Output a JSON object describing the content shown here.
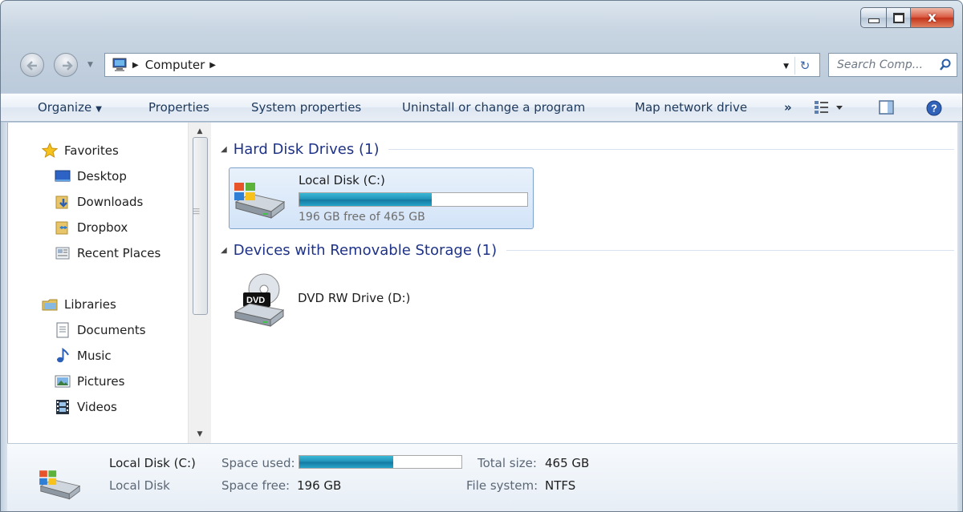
{
  "window": {
    "close_symbol": "x"
  },
  "address": {
    "crumb": "Computer",
    "search_placeholder": "Search Comp..."
  },
  "toolbar": {
    "organize": "Organize",
    "properties": "Properties",
    "system_properties": "System properties",
    "uninstall": "Uninstall or change a program",
    "map_drive": "Map network drive",
    "more": "»"
  },
  "sidebar": {
    "favorites_header": "Favorites",
    "favorites": [
      "Desktop",
      "Downloads",
      "Dropbox",
      "Recent Places"
    ],
    "libraries_header": "Libraries",
    "libraries": [
      "Documents",
      "Music",
      "Pictures",
      "Videos"
    ]
  },
  "groups": {
    "hard_disk": "Hard Disk Drives (1)",
    "removable": "Devices with Removable Storage (1)"
  },
  "drives": {
    "c_name": "Local Disk (C:)",
    "c_free_text": "196 GB free of 465 GB",
    "c_used_fraction": 0.58,
    "d_name": "DVD RW Drive (D:)",
    "dvd_badge": "DVD"
  },
  "details": {
    "name": "Local Disk (C:)",
    "type": "Local Disk",
    "space_used_label": "Space used:",
    "space_free_label": "Space free:",
    "space_free_value": "196 GB",
    "total_size_label": "Total size:",
    "total_size_value": "465 GB",
    "file_system_label": "File system:",
    "file_system_value": "NTFS"
  },
  "colors": {
    "group_header": "#1e3287",
    "bar_fill": "#1f90b6",
    "selection": "#d3e4f8"
  },
  "icons": [
    "back-arrow-icon",
    "forward-arrow-icon",
    "computer-icon",
    "refresh-icon",
    "search-icon",
    "view-options-icon",
    "preview-pane-icon",
    "help-icon",
    "star-icon",
    "desktop-icon",
    "downloads-folder-icon",
    "dropbox-folder-icon",
    "recent-places-icon",
    "libraries-icon",
    "documents-icon",
    "music-icon",
    "pictures-icon",
    "videos-icon",
    "hard-drive-icon",
    "dvd-drive-icon"
  ]
}
